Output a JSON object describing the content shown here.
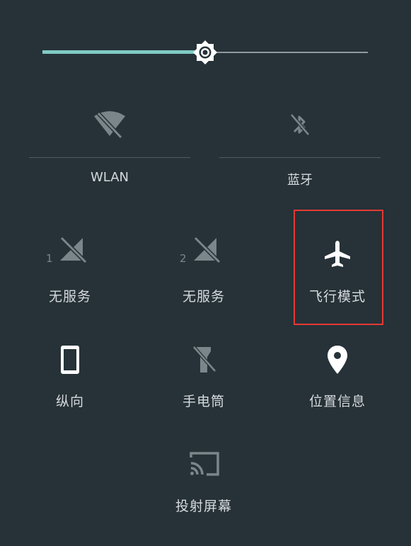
{
  "brightness": {
    "level": 0.5
  },
  "colors": {
    "background": "#263238",
    "accent": "#80cbc4",
    "icon_active": "#ffffff",
    "icon_inactive": "#7b868b",
    "highlight": "#e53935"
  },
  "tiles": {
    "wlan": {
      "label": "WLAN",
      "icon": "wifi-off-icon",
      "active": false
    },
    "bluetooth": {
      "label": "蓝牙",
      "icon": "bluetooth-off-icon",
      "active": false
    },
    "sim1": {
      "label": "无服务",
      "badge": "1",
      "icon": "no-signal-icon",
      "active": false
    },
    "sim2": {
      "label": "无服务",
      "badge": "2",
      "icon": "no-signal-icon",
      "active": false
    },
    "airplane": {
      "label": "飞行模式",
      "icon": "airplane-icon",
      "active": true
    },
    "rotation": {
      "label": "纵向",
      "icon": "phone-portrait-icon",
      "active": true
    },
    "flashlight": {
      "label": "手电筒",
      "icon": "flashlight-off-icon",
      "active": false
    },
    "location": {
      "label": "位置信息",
      "icon": "location-pin-icon",
      "active": true
    },
    "cast": {
      "label": "投射屏幕",
      "icon": "cast-icon",
      "active": false
    }
  }
}
